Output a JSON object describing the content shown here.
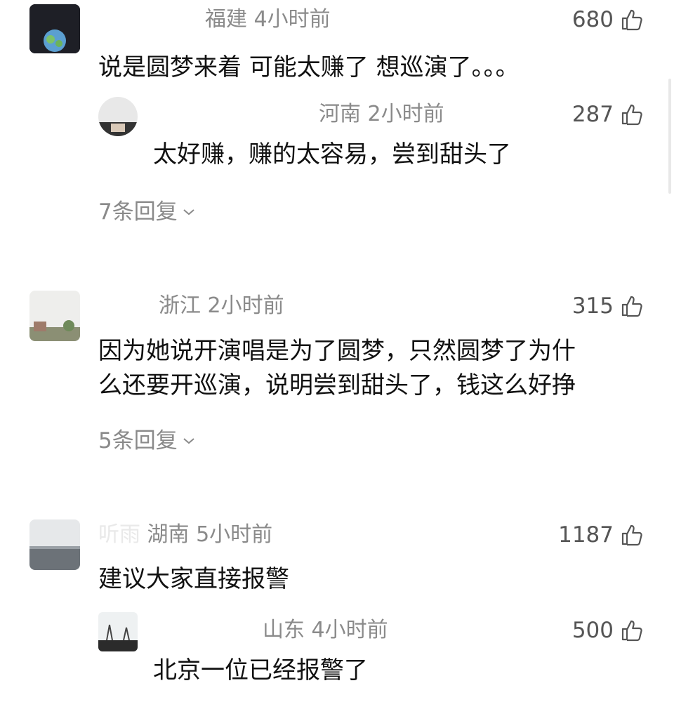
{
  "comments": [
    {
      "location": "福建",
      "time": "4小时前",
      "likes": "680",
      "text": "说是圆梦来着 可能太赚了 想巡演了。。。",
      "reply": {
        "location": "河南",
        "time": "2小时前",
        "likes": "287",
        "text": "太好赚，赚的太容易，尝到甜头了"
      },
      "more_replies": "7条回复"
    },
    {
      "location": "浙江",
      "time": "2小时前",
      "likes": "315",
      "text_line1": "因为她说开演唱是为了圆梦，只然圆梦了为什",
      "text_line2": "么还要开巡演，说明尝到甜头了，钱这么好挣",
      "more_replies": "5条回复"
    },
    {
      "blurred_name": "听雨",
      "location": "湖南",
      "time": "5小时前",
      "likes": "1187",
      "text": "建议大家直接报警",
      "reply": {
        "location": "山东",
        "time": "4小时前",
        "likes": "500",
        "text": "北京一位已经报警了"
      }
    }
  ],
  "icons": {
    "like": "thumbs-up-icon",
    "expand": "chevron-down-icon"
  }
}
